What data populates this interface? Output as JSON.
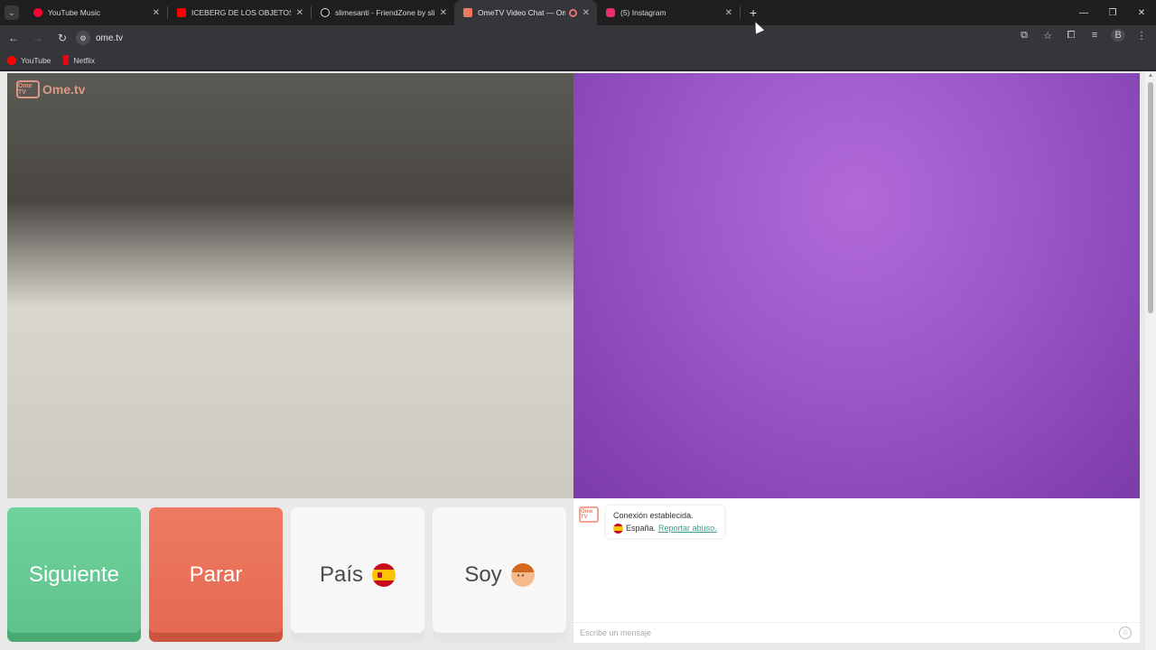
{
  "browser": {
    "tabs": [
      {
        "title": "YouTube Music",
        "favicon_color": "#ff0033",
        "active": false
      },
      {
        "title": "ICEBERG DE LOS OBJETOS PERD",
        "favicon_color": "#ff0000",
        "active": false
      },
      {
        "title": "slimesanti - FriendZone by slime",
        "favicon_color": "#ffffff",
        "active": false
      },
      {
        "title": "OmeTV Video Chat — Ome",
        "favicon_color": "#f07a5f",
        "active": true
      },
      {
        "title": "(5) Instagram",
        "favicon_color": "#e1306c",
        "active": false
      }
    ],
    "url": "ome.tv",
    "profile_initial": "B",
    "bookmarks": [
      {
        "label": "YouTube"
      },
      {
        "label": "Netflix"
      }
    ]
  },
  "page": {
    "logo_text": "Ome.tv",
    "logo_badge": "Ome TV",
    "buttons": {
      "next": "Siguiente",
      "stop": "Parar",
      "country": "País",
      "gender": "Soy"
    },
    "chat": {
      "system_message": "Conexión establecida.",
      "country_name": "España.",
      "report_link": "Reportar abuso.",
      "input_placeholder": "Escribe un mensaje"
    }
  },
  "colors": {
    "next_button": "#5fc08b",
    "stop_button": "#e4684f",
    "report_link": "#3a9b8a"
  }
}
